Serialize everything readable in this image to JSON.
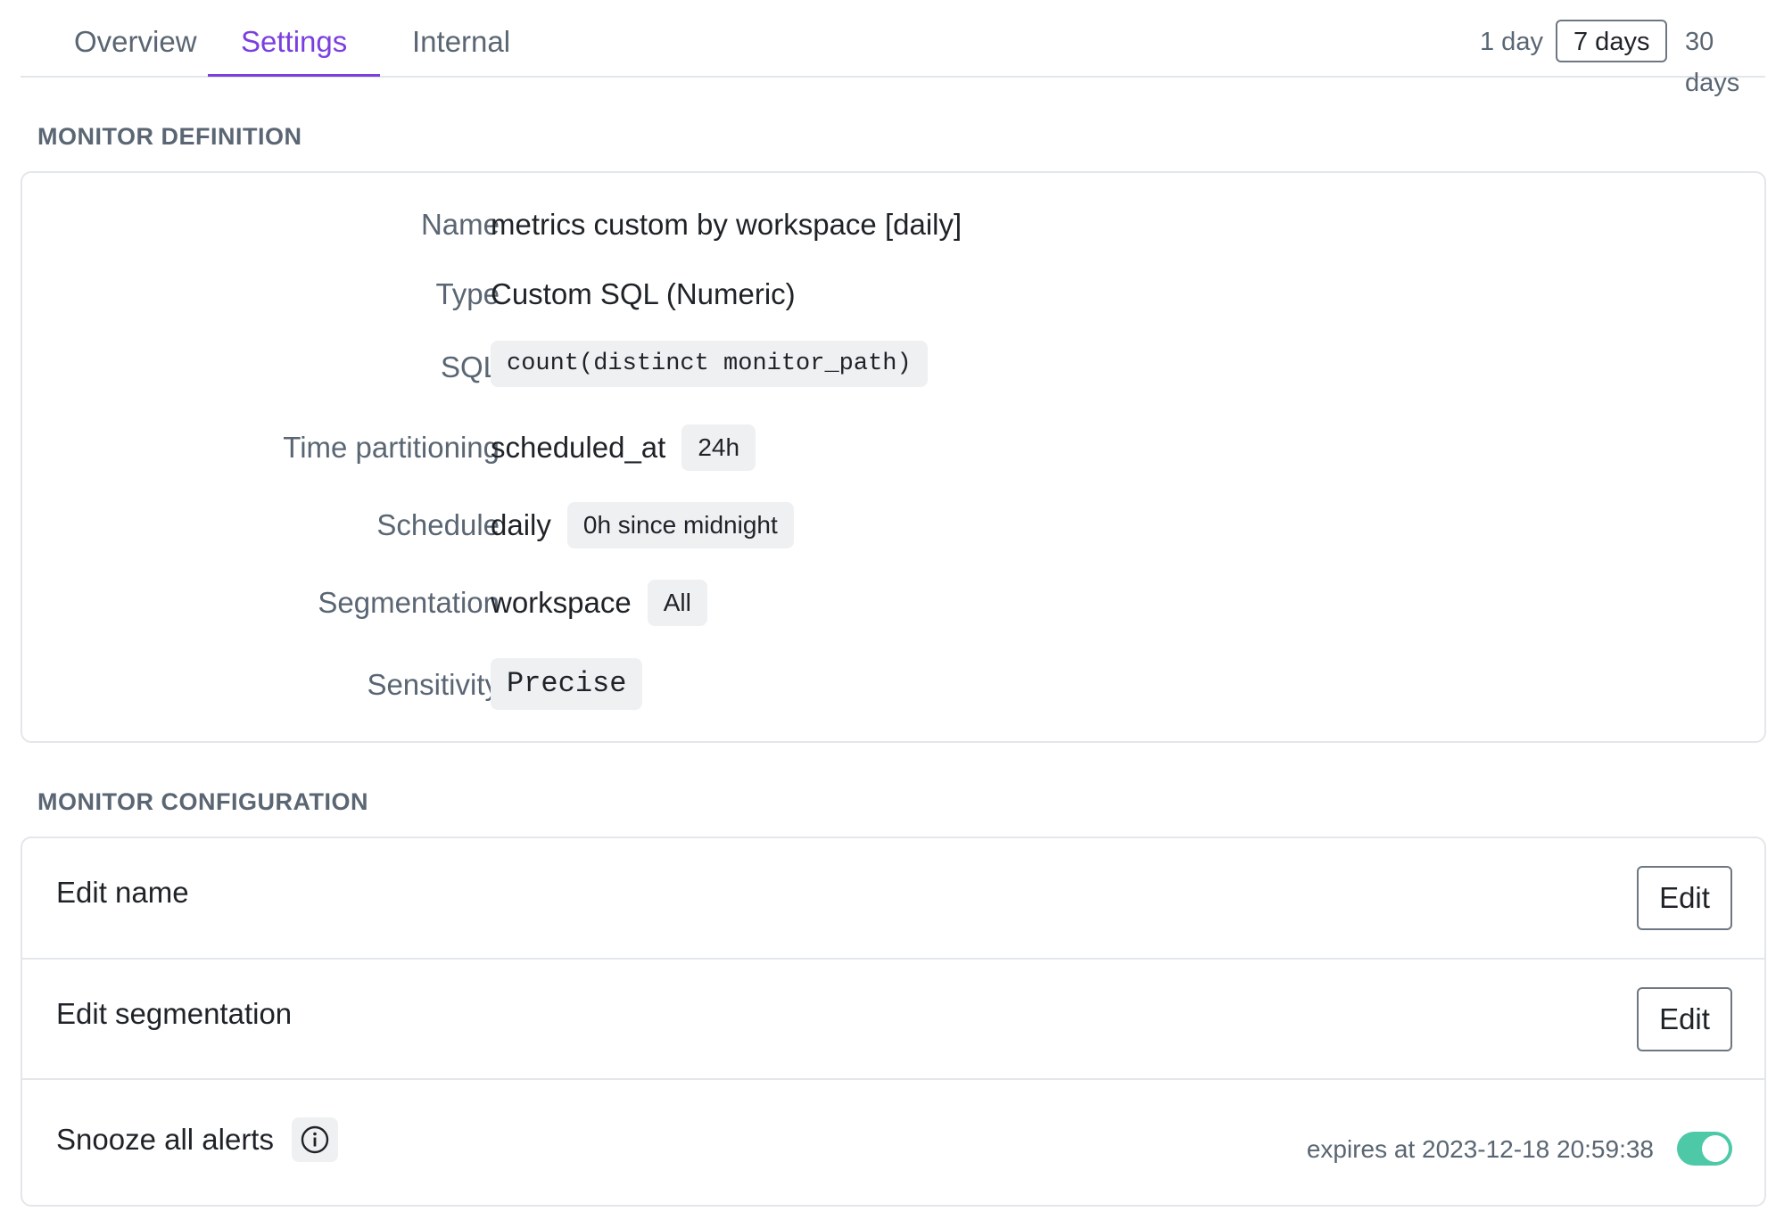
{
  "tabs": [
    {
      "label": "Overview",
      "active": false
    },
    {
      "label": "Settings",
      "active": true
    },
    {
      "label": "Internal",
      "active": false
    }
  ],
  "time_range": {
    "options": [
      "1 day",
      "7 days",
      "30 days"
    ],
    "selected": "7 days"
  },
  "definition": {
    "heading": "MONITOR DEFINITION",
    "name": {
      "label": "Name",
      "value": "metrics custom by workspace [daily]"
    },
    "type": {
      "label": "Type",
      "value": "Custom SQL (Numeric)"
    },
    "sql": {
      "label": "SQL",
      "value": "count(distinct monitor_path)"
    },
    "time_partitioning": {
      "label": "Time partitioning",
      "value": "scheduled_at",
      "chip": "24h"
    },
    "schedule": {
      "label": "Schedule",
      "value": "daily",
      "chip": "0h since midnight"
    },
    "segmentation": {
      "label": "Segmentation",
      "value": "workspace",
      "chip": "All"
    },
    "sensitivity": {
      "label": "Sensitivity",
      "value": "Precise"
    }
  },
  "configuration": {
    "heading": "MONITOR CONFIGURATION",
    "edit_name": {
      "label": "Edit name",
      "button": "Edit"
    },
    "edit_segmentation": {
      "label": "Edit segmentation",
      "button": "Edit"
    },
    "snooze": {
      "label": "Snooze all alerts",
      "expires": "expires at 2023-12-18 20:59:38",
      "enabled": true
    }
  },
  "colors": {
    "accent": "#7b3fe0",
    "toggle_on": "#4ec9a8",
    "muted_text": "#5a6673",
    "border": "#e3e6ea",
    "chip_bg": "#eef0f2"
  },
  "icons": {
    "info": "info-circle-icon"
  }
}
